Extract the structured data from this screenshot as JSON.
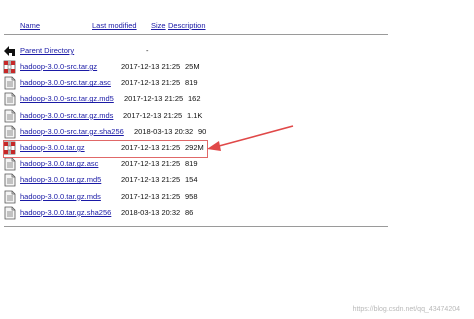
{
  "header": {
    "name": "Name",
    "last_modified": "Last modified",
    "size": "Size",
    "description": "Description"
  },
  "parent": {
    "label": "Parent Directory",
    "size": "-",
    "icon": "back-arrow-icon"
  },
  "files": [
    {
      "name": "hadoop-3.0.0-src.tar.gz",
      "modified": "2017-12-13 21:25",
      "size": "25M",
      "icon": "archive-icon"
    },
    {
      "name": "hadoop-3.0.0-src.tar.gz.asc",
      "modified": "2017-12-13 21:25",
      "size": "819",
      "icon": "text-file-icon"
    },
    {
      "name": "hadoop-3.0.0-src.tar.gz.md5",
      "modified": "2017-12-13 21:25",
      "size": "162",
      "icon": "text-file-icon"
    },
    {
      "name": "hadoop-3.0.0-src.tar.gz.mds",
      "modified": "2017-12-13 21:25",
      "size": "1.1K",
      "icon": "text-file-icon"
    },
    {
      "name": "hadoop-3.0.0-src.tar.gz.sha256",
      "modified": "2018-03-13 20:32",
      "size": "90",
      "icon": "text-file-icon"
    },
    {
      "name": "hadoop-3.0.0.tar.gz",
      "modified": "2017-12-13 21:25",
      "size": "292M",
      "icon": "archive-icon"
    },
    {
      "name": "hadoop-3.0.0.tar.gz.asc",
      "modified": "2017-12-13 21:25",
      "size": "819",
      "icon": "text-file-icon"
    },
    {
      "name": "hadoop-3.0.0.tar.gz.md5",
      "modified": "2017-12-13 21:25",
      "size": "154",
      "icon": "text-file-icon"
    },
    {
      "name": "hadoop-3.0.0.tar.gz.mds",
      "modified": "2017-12-13 21:25",
      "size": "958",
      "icon": "text-file-icon"
    },
    {
      "name": "hadoop-3.0.0.tar.gz.sha256",
      "modified": "2018-03-13 20:32",
      "size": "86",
      "icon": "text-file-icon"
    }
  ],
  "annotation": {
    "color": "#e04848"
  },
  "watermark": "https://blog.csdn.net/qq_43474204"
}
